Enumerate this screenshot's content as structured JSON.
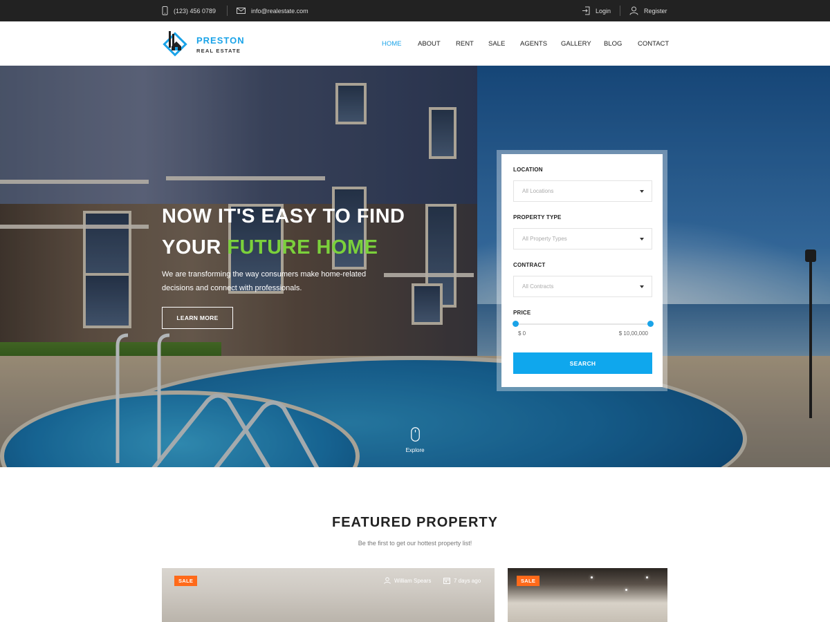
{
  "topbar": {
    "phone": "(123) 456 0789",
    "email": "info@realestate.com",
    "login": "Login",
    "register": "Register"
  },
  "brand": {
    "name": "PRESTON",
    "tagline": "REAL ESTATE"
  },
  "nav": [
    {
      "label": "HOME",
      "active": true
    },
    {
      "label": "ABOUT",
      "active": false
    },
    {
      "label": "RENT",
      "active": false
    },
    {
      "label": "SALE",
      "active": false
    },
    {
      "label": "AGENTS",
      "active": false
    },
    {
      "label": "GALLERY",
      "active": false
    },
    {
      "label": "BLOG",
      "active": false
    },
    {
      "label": "CONTACT",
      "active": false
    }
  ],
  "hero": {
    "title_line1": "NOW IT'S EASY TO FIND",
    "title_line2_prefix": "YOUR ",
    "title_line2_highlight": "FUTURE HOME",
    "description": "We are transforming the way consumers make home-related decisions and connect with professionals.",
    "cta": "LEARN MORE",
    "explore": "Explore"
  },
  "search": {
    "location_label": "LOCATION",
    "location_value": "All Locations",
    "type_label": "PROPERTY TYPE",
    "type_value": "All Property Types",
    "contract_label": "CONTRACT",
    "contract_value": "All Contracts",
    "price_label": "PRICE",
    "price_min": "$ 0",
    "price_max": "$ 10,00,000",
    "button": "SEARCH"
  },
  "featured": {
    "title": "FEATURED PROPERTY",
    "subtitle": "Be the first to get our hottest property list!",
    "cards": [
      {
        "badge": "SALE",
        "author": "William Spears",
        "date": "7 days ago"
      },
      {
        "badge": "SALE"
      }
    ]
  },
  "colors": {
    "accent": "#1aa3e8",
    "highlight": "#7bd13b",
    "badge": "#ff6a1a",
    "topbar": "#222222"
  }
}
